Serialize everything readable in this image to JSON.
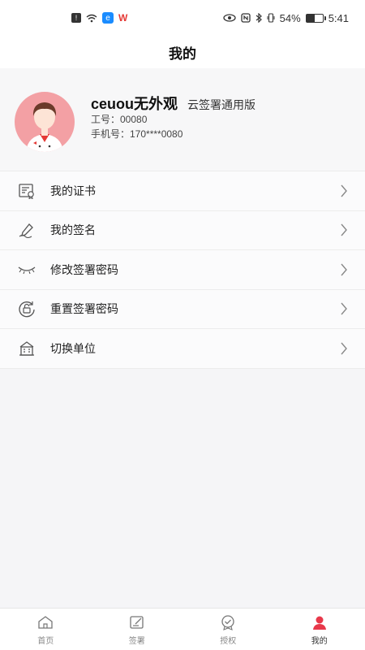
{
  "status_bar": {
    "battery_percent": "54%",
    "battery_level": 0.54,
    "time": "5:41",
    "app_badge_char": "W"
  },
  "nav": {
    "title": "我的"
  },
  "profile": {
    "name": "ceuou无外观",
    "version": "云签署通用版",
    "employee_id": "工号：00080",
    "phone": "手机号：170****0080"
  },
  "menu": {
    "items": [
      {
        "label": "我的证书",
        "icon": "certificate-icon"
      },
      {
        "label": "我的签名",
        "icon": "pen-icon"
      },
      {
        "label": "修改签署密码",
        "icon": "eye-closed-icon"
      },
      {
        "label": "重置签署密码",
        "icon": "reset-lock-icon"
      },
      {
        "label": "切换单位",
        "icon": "building-icon"
      }
    ]
  },
  "tabbar": {
    "items": [
      {
        "label": "首页",
        "icon": "home-icon",
        "active": false
      },
      {
        "label": "签署",
        "icon": "sign-icon",
        "active": false
      },
      {
        "label": "授权",
        "icon": "authorize-icon",
        "active": false
      },
      {
        "label": "我的",
        "icon": "profile-icon",
        "active": true
      }
    ],
    "active_color": "#e8384a"
  }
}
